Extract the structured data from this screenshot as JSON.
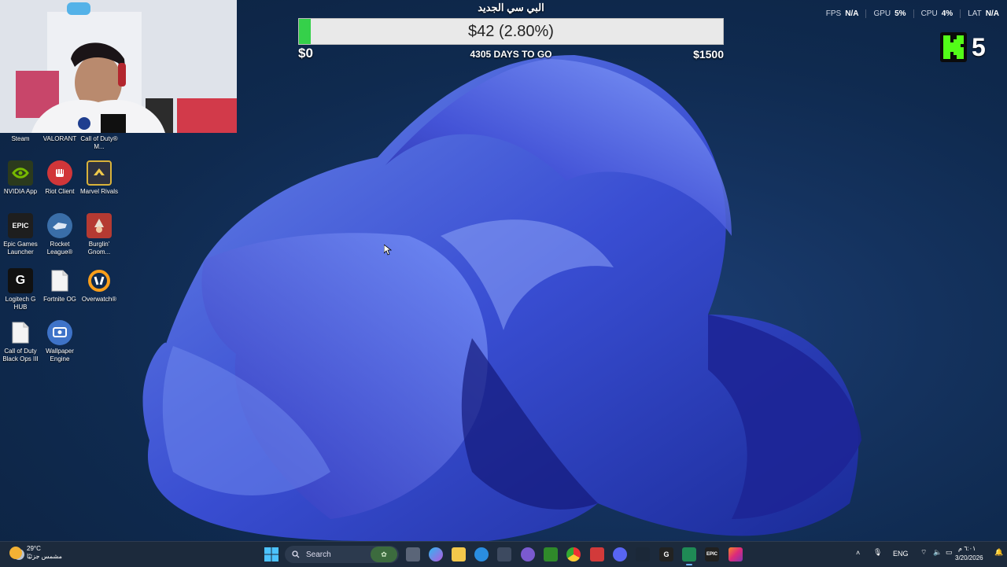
{
  "goal": {
    "title": "البي سي الجديد",
    "amount_text": "$42 (2.80%)",
    "progress_percent": 2.8,
    "min_label": "$0",
    "days_text": "4305 DAYS TO GO",
    "max_label": "$1500",
    "fill_color": "#35d04a"
  },
  "stats": [
    {
      "label": "FPS",
      "value": "N/A"
    },
    {
      "label": "GPU",
      "value": "5%"
    },
    {
      "label": "CPU",
      "value": "4%"
    },
    {
      "label": "LAT",
      "value": "N/A"
    }
  ],
  "kick": {
    "logo": "kick-logo",
    "count": "5",
    "color": "#53fc18"
  },
  "desktop_icons": {
    "steam": "Steam",
    "valorant": "VALORANT",
    "cod_mw": "Call of Duty® M...",
    "nvidia": "NVIDIA App",
    "riot": "Riot Client",
    "marvel": "Marvel Rivals",
    "epic": "Epic Games Launcher",
    "rocket": "Rocket League®",
    "burglin": "Burglin' Gnom...",
    "logitech": "Logitech G HUB",
    "fortnite": "Fortnite OG",
    "overwatch": "Overwatch®",
    "cod_bo3": "Call of Duty Black Ops III",
    "wallpaper": "Wallpaper Engine"
  },
  "icon_glyphs": {
    "epic": "EPIC",
    "logitech": "G"
  },
  "taskbar": {
    "weather_temp": "29°C",
    "weather_desc": "مشمس جزئيًا",
    "search_placeholder": "Search",
    "tray_language": "ENG",
    "tray_time": "٦:٠١ م",
    "tray_date": "3/20/2026"
  }
}
